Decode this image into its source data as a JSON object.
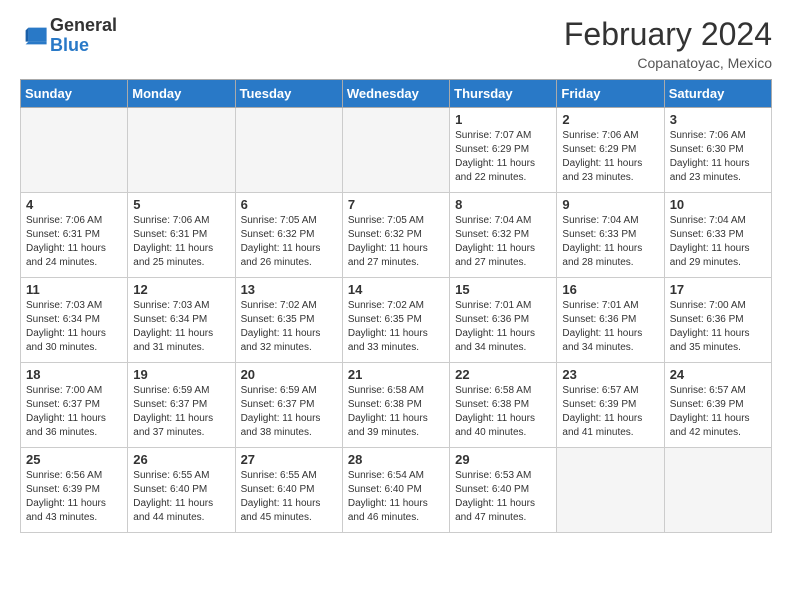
{
  "logo": {
    "general": "General",
    "blue": "Blue"
  },
  "title": "February 2024",
  "location": "Copanatoyac, Mexico",
  "weekdays": [
    "Sunday",
    "Monday",
    "Tuesday",
    "Wednesday",
    "Thursday",
    "Friday",
    "Saturday"
  ],
  "weeks": [
    [
      {
        "day": "",
        "info": ""
      },
      {
        "day": "",
        "info": ""
      },
      {
        "day": "",
        "info": ""
      },
      {
        "day": "",
        "info": ""
      },
      {
        "day": "1",
        "info": "Sunrise: 7:07 AM\nSunset: 6:29 PM\nDaylight: 11 hours\nand 22 minutes."
      },
      {
        "day": "2",
        "info": "Sunrise: 7:06 AM\nSunset: 6:29 PM\nDaylight: 11 hours\nand 23 minutes."
      },
      {
        "day": "3",
        "info": "Sunrise: 7:06 AM\nSunset: 6:30 PM\nDaylight: 11 hours\nand 23 minutes."
      }
    ],
    [
      {
        "day": "4",
        "info": "Sunrise: 7:06 AM\nSunset: 6:31 PM\nDaylight: 11 hours\nand 24 minutes."
      },
      {
        "day": "5",
        "info": "Sunrise: 7:06 AM\nSunset: 6:31 PM\nDaylight: 11 hours\nand 25 minutes."
      },
      {
        "day": "6",
        "info": "Sunrise: 7:05 AM\nSunset: 6:32 PM\nDaylight: 11 hours\nand 26 minutes."
      },
      {
        "day": "7",
        "info": "Sunrise: 7:05 AM\nSunset: 6:32 PM\nDaylight: 11 hours\nand 27 minutes."
      },
      {
        "day": "8",
        "info": "Sunrise: 7:04 AM\nSunset: 6:32 PM\nDaylight: 11 hours\nand 27 minutes."
      },
      {
        "day": "9",
        "info": "Sunrise: 7:04 AM\nSunset: 6:33 PM\nDaylight: 11 hours\nand 28 minutes."
      },
      {
        "day": "10",
        "info": "Sunrise: 7:04 AM\nSunset: 6:33 PM\nDaylight: 11 hours\nand 29 minutes."
      }
    ],
    [
      {
        "day": "11",
        "info": "Sunrise: 7:03 AM\nSunset: 6:34 PM\nDaylight: 11 hours\nand 30 minutes."
      },
      {
        "day": "12",
        "info": "Sunrise: 7:03 AM\nSunset: 6:34 PM\nDaylight: 11 hours\nand 31 minutes."
      },
      {
        "day": "13",
        "info": "Sunrise: 7:02 AM\nSunset: 6:35 PM\nDaylight: 11 hours\nand 32 minutes."
      },
      {
        "day": "14",
        "info": "Sunrise: 7:02 AM\nSunset: 6:35 PM\nDaylight: 11 hours\nand 33 minutes."
      },
      {
        "day": "15",
        "info": "Sunrise: 7:01 AM\nSunset: 6:36 PM\nDaylight: 11 hours\nand 34 minutes."
      },
      {
        "day": "16",
        "info": "Sunrise: 7:01 AM\nSunset: 6:36 PM\nDaylight: 11 hours\nand 34 minutes."
      },
      {
        "day": "17",
        "info": "Sunrise: 7:00 AM\nSunset: 6:36 PM\nDaylight: 11 hours\nand 35 minutes."
      }
    ],
    [
      {
        "day": "18",
        "info": "Sunrise: 7:00 AM\nSunset: 6:37 PM\nDaylight: 11 hours\nand 36 minutes."
      },
      {
        "day": "19",
        "info": "Sunrise: 6:59 AM\nSunset: 6:37 PM\nDaylight: 11 hours\nand 37 minutes."
      },
      {
        "day": "20",
        "info": "Sunrise: 6:59 AM\nSunset: 6:37 PM\nDaylight: 11 hours\nand 38 minutes."
      },
      {
        "day": "21",
        "info": "Sunrise: 6:58 AM\nSunset: 6:38 PM\nDaylight: 11 hours\nand 39 minutes."
      },
      {
        "day": "22",
        "info": "Sunrise: 6:58 AM\nSunset: 6:38 PM\nDaylight: 11 hours\nand 40 minutes."
      },
      {
        "day": "23",
        "info": "Sunrise: 6:57 AM\nSunset: 6:39 PM\nDaylight: 11 hours\nand 41 minutes."
      },
      {
        "day": "24",
        "info": "Sunrise: 6:57 AM\nSunset: 6:39 PM\nDaylight: 11 hours\nand 42 minutes."
      }
    ],
    [
      {
        "day": "25",
        "info": "Sunrise: 6:56 AM\nSunset: 6:39 PM\nDaylight: 11 hours\nand 43 minutes."
      },
      {
        "day": "26",
        "info": "Sunrise: 6:55 AM\nSunset: 6:40 PM\nDaylight: 11 hours\nand 44 minutes."
      },
      {
        "day": "27",
        "info": "Sunrise: 6:55 AM\nSunset: 6:40 PM\nDaylight: 11 hours\nand 45 minutes."
      },
      {
        "day": "28",
        "info": "Sunrise: 6:54 AM\nSunset: 6:40 PM\nDaylight: 11 hours\nand 46 minutes."
      },
      {
        "day": "29",
        "info": "Sunrise: 6:53 AM\nSunset: 6:40 PM\nDaylight: 11 hours\nand 47 minutes."
      },
      {
        "day": "",
        "info": ""
      },
      {
        "day": "",
        "info": ""
      }
    ]
  ]
}
